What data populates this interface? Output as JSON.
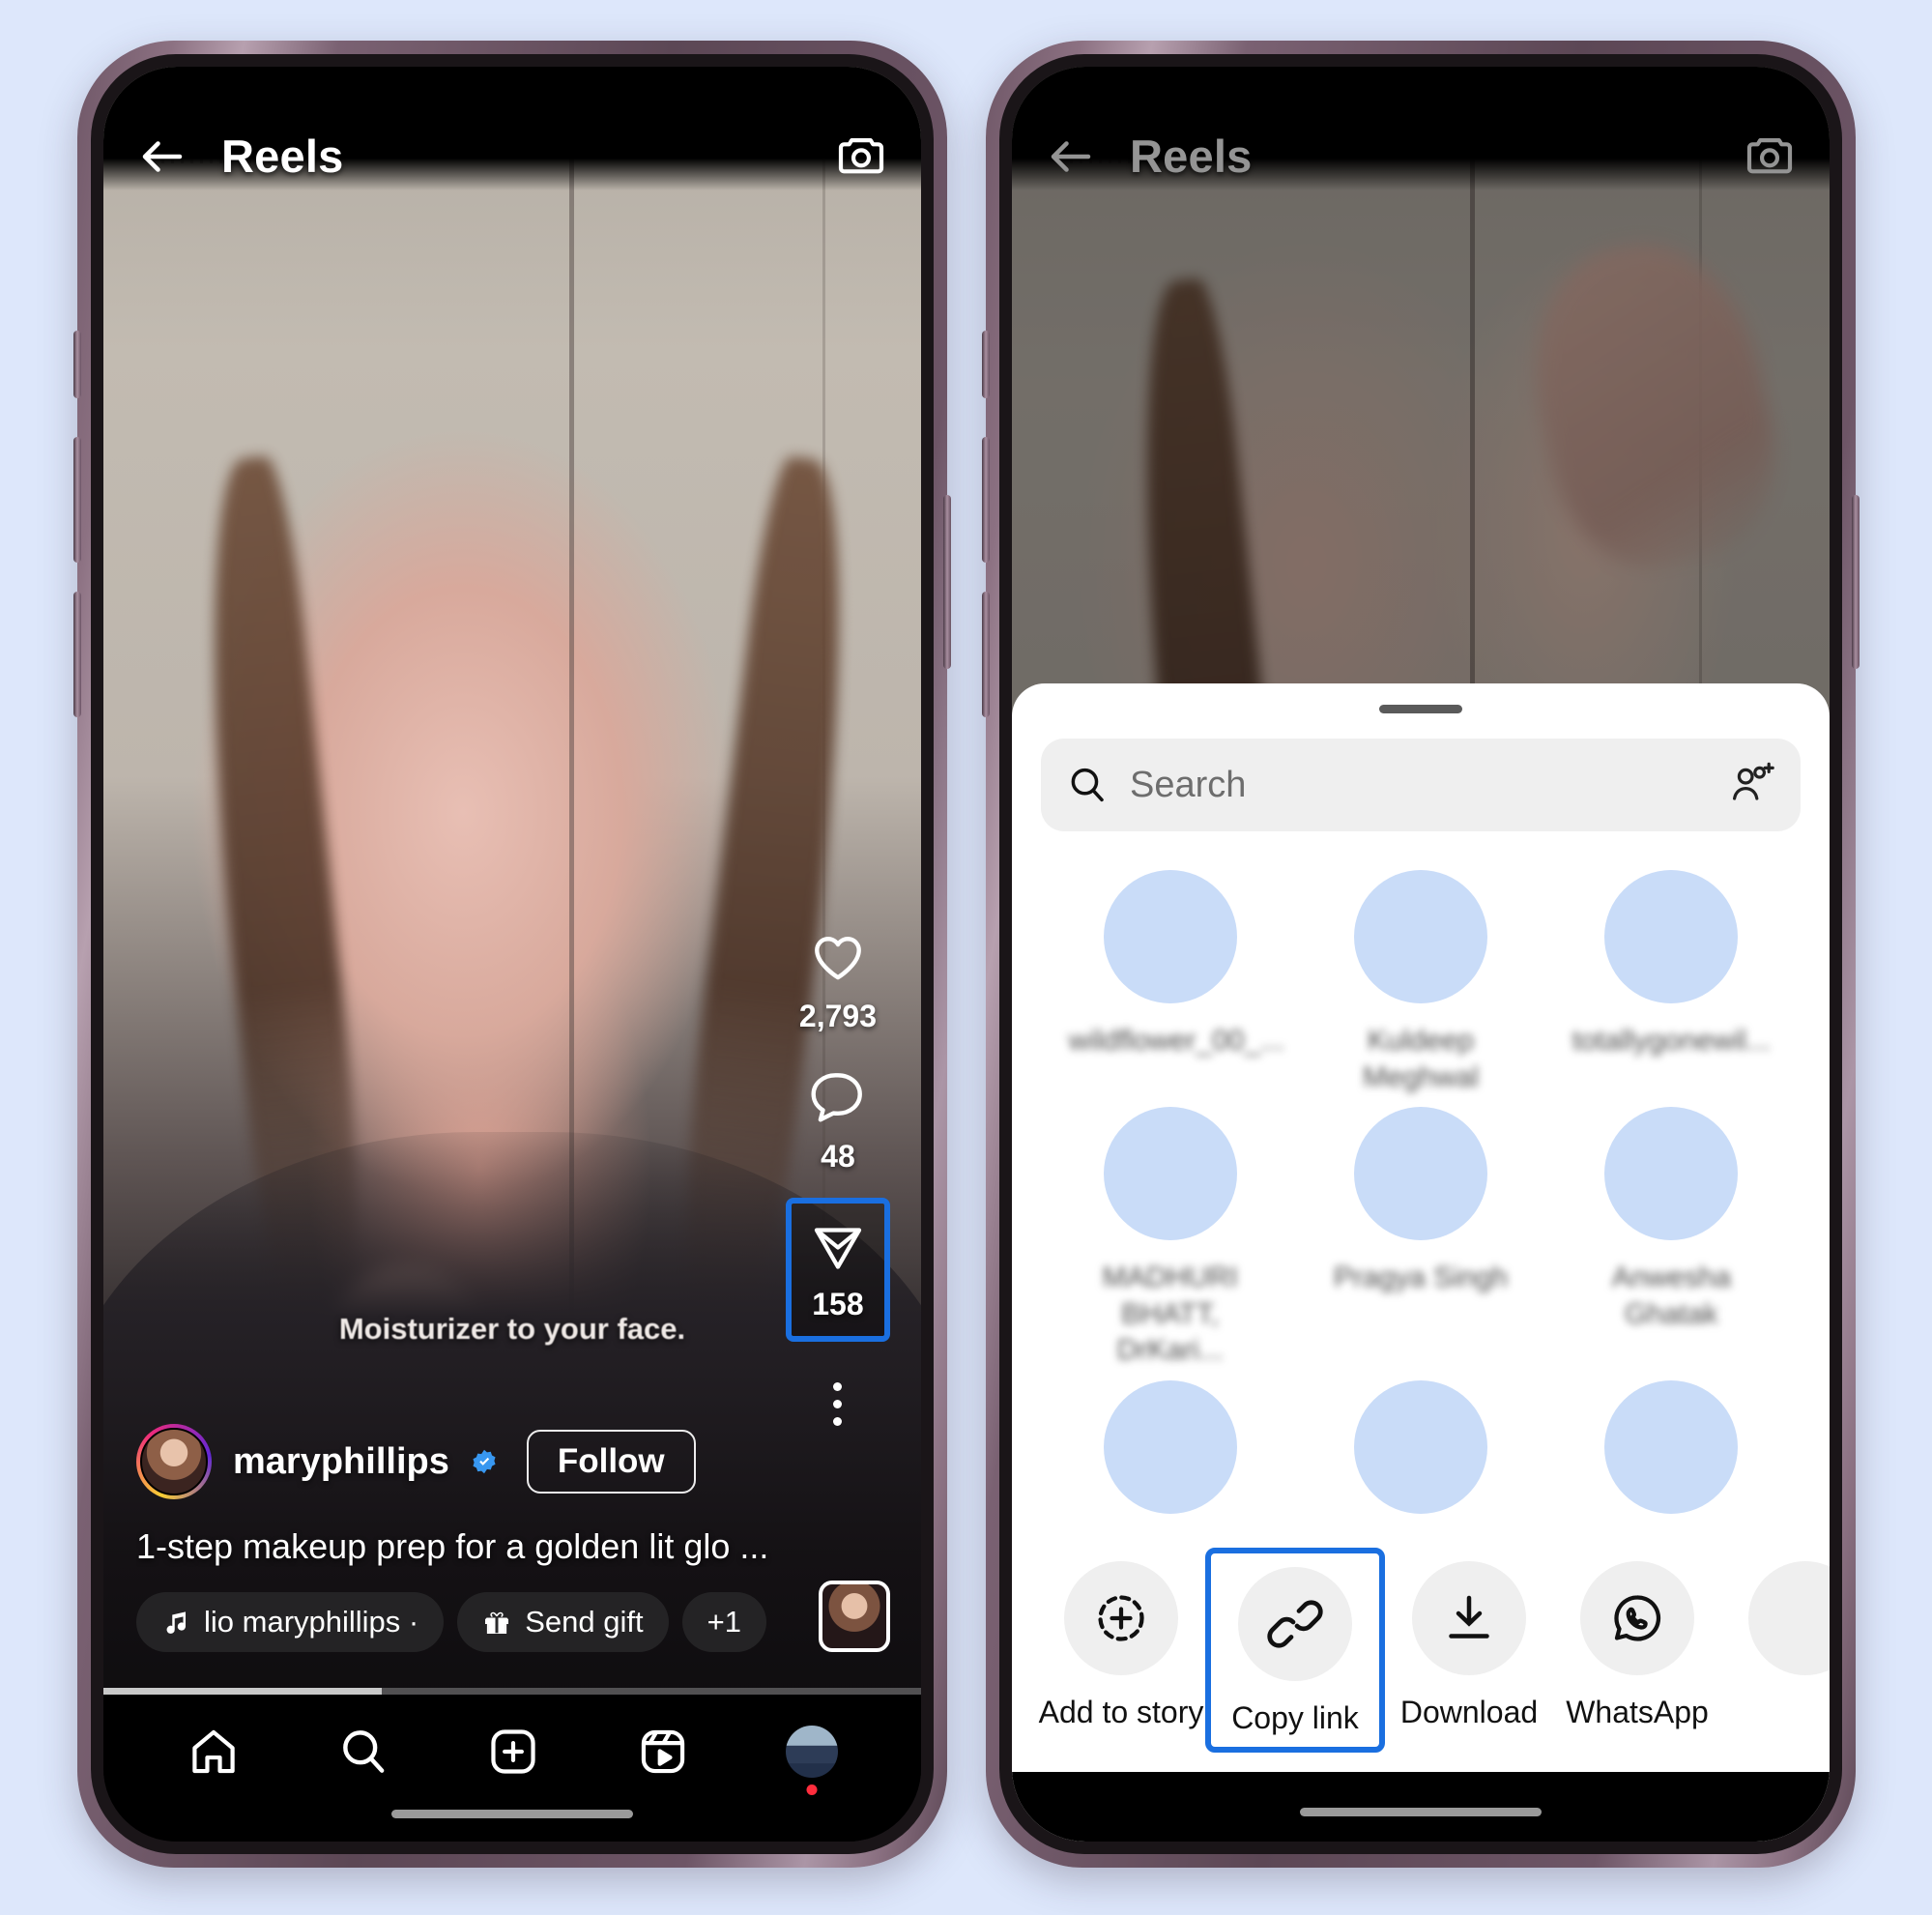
{
  "background_color": "#dde7fb",
  "highlight_color": "#1a6fe0",
  "left_phone": {
    "header": {
      "title": "Reels",
      "back_icon": "back-arrow-icon",
      "camera_icon": "camera-icon"
    },
    "video_sticker_text": "Moisturizer to your face.",
    "actions": [
      {
        "icon": "heart-icon",
        "count": "2,793",
        "highlighted": false
      },
      {
        "icon": "comment-icon",
        "count": "48",
        "highlighted": false
      },
      {
        "icon": "share-paperplane-icon",
        "count": "158",
        "highlighted": true
      }
    ],
    "more_icon": "more-vertical-icon",
    "account": {
      "username": "maryphillips",
      "verified_badge": "verified-badge-icon",
      "follow_label": "Follow"
    },
    "caption": "1-step makeup prep for a golden lit glo ...",
    "chips": [
      {
        "icon": "music-note-icon",
        "label": "lio   maryphillips ·"
      },
      {
        "icon": "gift-icon",
        "label": "Send gift"
      },
      {
        "icon": "",
        "label": "+1"
      }
    ],
    "thumbnail": "reel-thumbnail",
    "progress_percent": 34,
    "navbar": [
      {
        "name": "home-icon",
        "label": "Home"
      },
      {
        "name": "search-icon",
        "label": "Search"
      },
      {
        "name": "create-plus-icon",
        "label": "Create"
      },
      {
        "name": "reels-icon",
        "label": "Reels"
      },
      {
        "name": "profile-avatar",
        "label": "Profile"
      }
    ]
  },
  "right_phone": {
    "header": {
      "title": "Reels",
      "back_icon": "back-arrow-icon",
      "camera_icon": "camera-icon"
    },
    "share_sheet": {
      "search": {
        "placeholder": "Search",
        "icon": "search-icon",
        "add_people_icon": "add-people-icon"
      },
      "contacts": [
        {
          "name": "wildflower_00_..."
        },
        {
          "name": "Kuldeep Meghwal"
        },
        {
          "name": "totallygonewil..."
        },
        {
          "name": "MADHURI BHATT, DrKari..."
        },
        {
          "name": "Pragya Singh"
        },
        {
          "name": "Anwesha Ghatak"
        },
        {
          "name": ""
        },
        {
          "name": ""
        },
        {
          "name": ""
        }
      ],
      "actions": [
        {
          "label": "Add to story",
          "icon": "add-to-story-icon",
          "highlighted": false
        },
        {
          "label": "Copy link",
          "icon": "link-icon",
          "highlighted": true
        },
        {
          "label": "Download",
          "icon": "download-icon",
          "highlighted": false
        },
        {
          "label": "WhatsApp",
          "icon": "whatsapp-icon",
          "highlighted": false
        },
        {
          "label": "",
          "icon": "more-apps-icon",
          "highlighted": false
        }
      ]
    }
  }
}
